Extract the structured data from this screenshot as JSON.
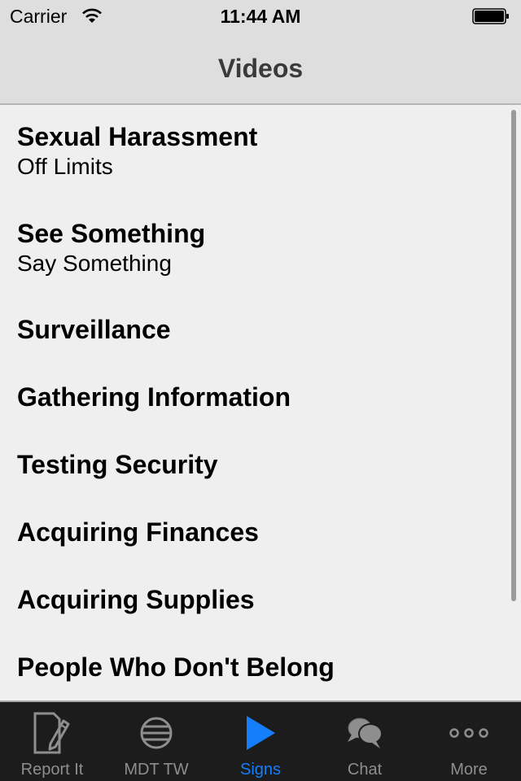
{
  "status_bar": {
    "carrier": "Carrier",
    "time": "11:44 AM",
    "wifi_icon": "wifi-icon",
    "battery_icon": "battery-full-icon"
  },
  "nav": {
    "title": "Videos"
  },
  "videos": [
    {
      "title": "Sexual Harassment",
      "subtitle": "Off Limits"
    },
    {
      "title": "See Something",
      "subtitle": "Say Something"
    },
    {
      "title": "Surveillance"
    },
    {
      "title": "Gathering Information"
    },
    {
      "title": "Testing Security"
    },
    {
      "title": "Acquiring Finances"
    },
    {
      "title": "Acquiring Supplies"
    },
    {
      "title": "People Who Don't Belong"
    }
  ],
  "tabbar": {
    "active_color": "#147efb",
    "inactive_color": "#8e8e8e",
    "tabs": [
      {
        "label": "Report It",
        "icon": "report-edit-icon",
        "active": false
      },
      {
        "label": "MDT TW",
        "icon": "globe-icon",
        "active": false
      },
      {
        "label": "Signs",
        "icon": "play-icon",
        "active": true
      },
      {
        "label": "Chat",
        "icon": "chat-bubbles-icon",
        "active": false
      },
      {
        "label": "More",
        "icon": "more-dots-icon",
        "active": false
      }
    ]
  }
}
